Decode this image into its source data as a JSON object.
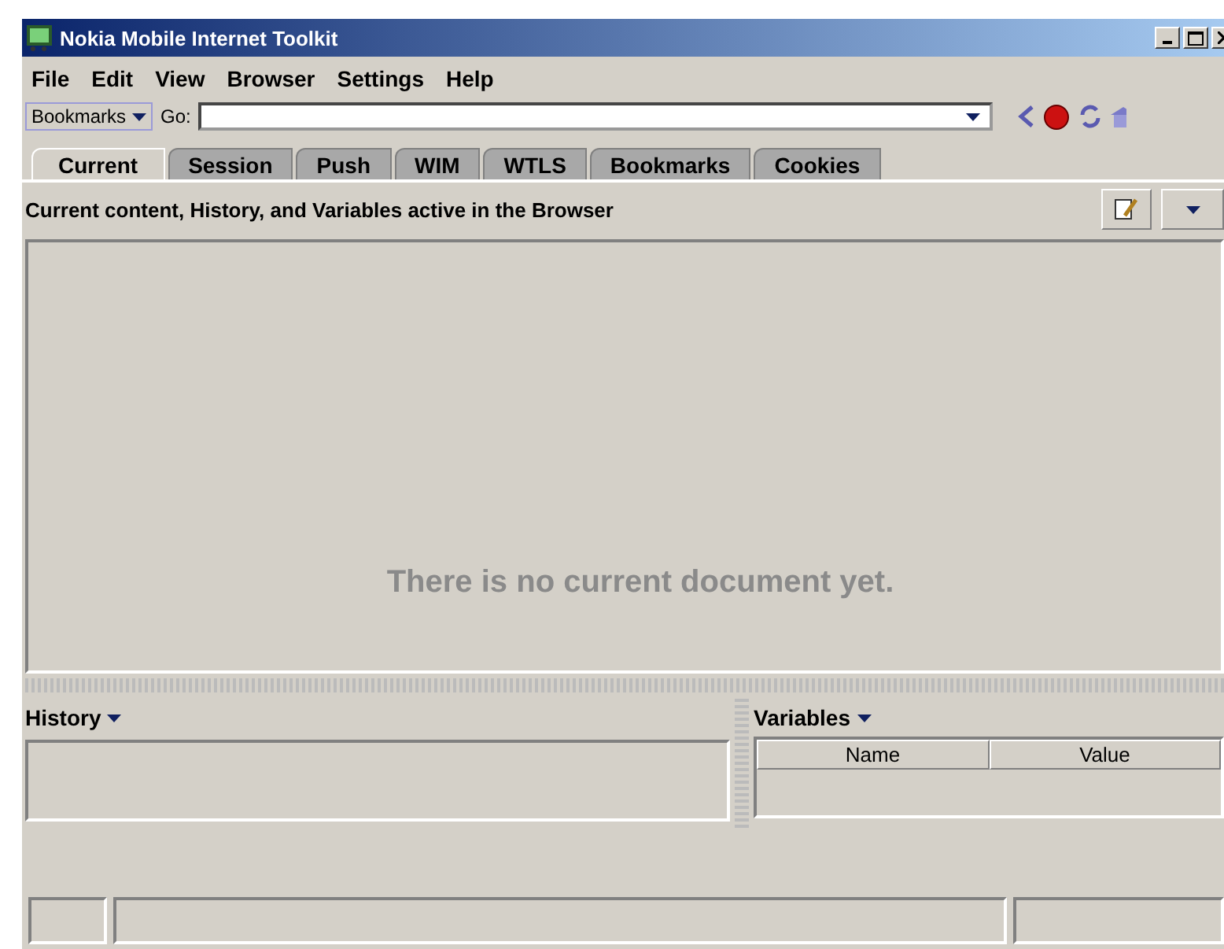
{
  "window": {
    "title": "Nokia Mobile Internet Toolkit"
  },
  "menu": [
    "File",
    "Edit",
    "View",
    "Browser",
    "Settings",
    "Help"
  ],
  "toolbar": {
    "bookmarks_label": "Bookmarks",
    "go_label": "Go:"
  },
  "tabs": [
    {
      "label": "Current",
      "selected": true
    },
    {
      "label": "Session",
      "selected": false
    },
    {
      "label": "Push",
      "selected": false
    },
    {
      "label": "WIM",
      "selected": false
    },
    {
      "label": "WTLS",
      "selected": false
    },
    {
      "label": "Bookmarks",
      "selected": false
    },
    {
      "label": "Cookies",
      "selected": false
    }
  ],
  "description": "Current content, History, and Variables active in the Browser",
  "main": {
    "message": "There is no current document yet."
  },
  "history": {
    "title": "History"
  },
  "variables": {
    "title": "Variables",
    "columns": [
      "Name",
      "Value"
    ]
  }
}
